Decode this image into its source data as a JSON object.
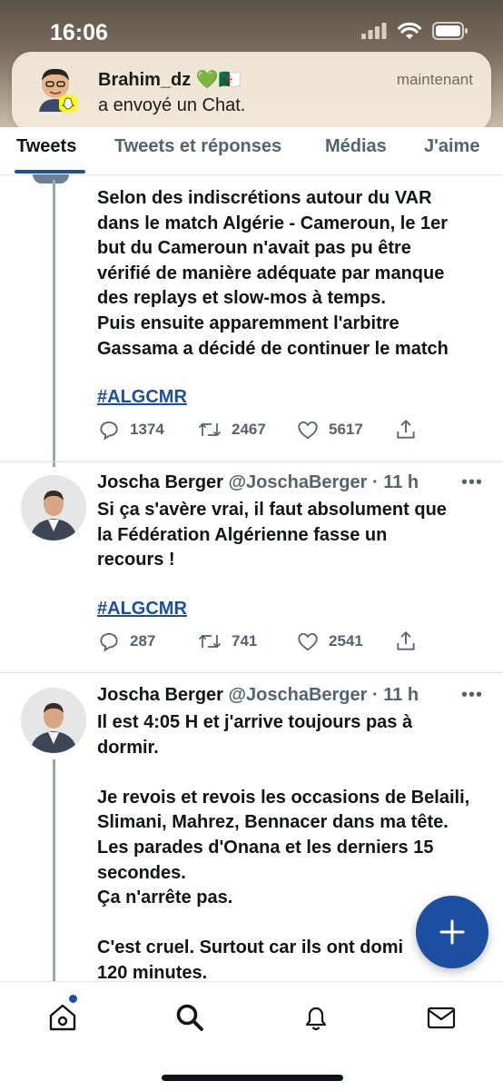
{
  "status_bar": {
    "time": "16:06"
  },
  "notification": {
    "title": "Brahim_dz 💚🇩🇿",
    "body": "a envoyé un Chat.",
    "time": "maintenant"
  },
  "tabs": [
    {
      "label": "Tweets",
      "active": true
    },
    {
      "label": "Tweets et réponses",
      "active": false
    },
    {
      "label": "Médias",
      "active": false
    },
    {
      "label": "J'aime",
      "active": false
    }
  ],
  "tweets": [
    {
      "text": "Selon des indiscrétions autour du VAR\ndans le match Algérie - Cameroun, le 1er\nbut du Cameroun n'avait pas pu être\nvérifié de manière adéquate par manque\ndes replays et slow-mos à temps.\nPuis ensuite apparemment l'arbitre\nGassama a décidé de continuer le match",
      "hashtag": "#ALGCMR",
      "replies": "1374",
      "retweets": "2467",
      "likes": "5617"
    },
    {
      "name": "Joscha Berger",
      "meta": "@JoschaBerger · 11 h",
      "text": "Si ça s'avère vrai, il faut absolument que\nla Fédération Algérienne fasse un\nrecours !",
      "hashtag": "#ALGCMR",
      "replies": "287",
      "retweets": "741",
      "likes": "2541"
    },
    {
      "name": "Joscha Berger",
      "meta": "@JoschaBerger · 11 h",
      "text": "Il est 4:05 H et j'arrive toujours pas à\ndormir.\n\nJe revois et revois les occasions de Belaili,\nSlimani, Mahrez, Bennacer dans ma tête.\nLes parades d'Onana et les derniers 15\nsecondes.\nÇa n'arrête pas.\n\nC'est cruel. Surtout car ils ont domi\n120 minutes."
    }
  ],
  "more_label": "•••",
  "colors": {
    "accent": "#1d4fa1",
    "text": "#0f1419",
    "secondary": "#536471"
  },
  "icons": [
    "reply-icon",
    "retweet-icon",
    "like-icon",
    "share-icon",
    "compose-plus-icon",
    "home-icon",
    "search-icon",
    "notifications-bell-icon",
    "messages-envelope-icon"
  ]
}
